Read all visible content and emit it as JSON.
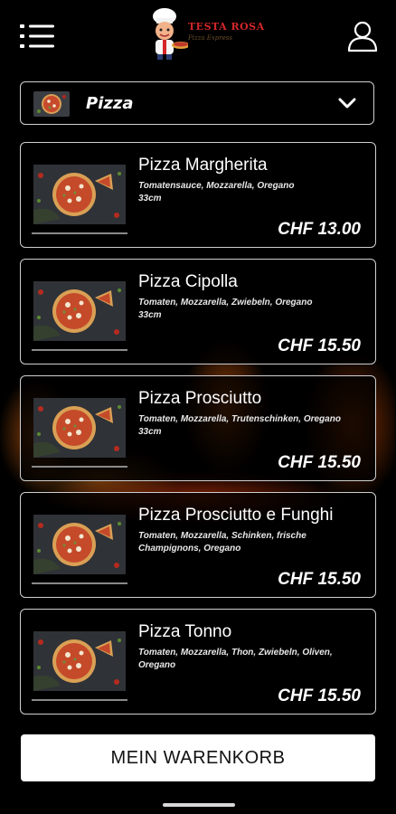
{
  "brand": {
    "name": "TESTA ROSA",
    "tagline": "Pizza Express"
  },
  "icons": {
    "menu": "menu-list-icon",
    "user": "user-icon",
    "dropdown": "chevron-down-icon"
  },
  "category": {
    "label": "Pizza"
  },
  "products": [
    {
      "name": "Pizza Margherita",
      "desc": "Tomatensauce, Mozzarella, Oregano",
      "size": "33cm",
      "price": "CHF 13.00"
    },
    {
      "name": "Pizza Cipolla",
      "desc": "Tomaten, Mozzarella, Zwiebeln, Oregano",
      "size": "33cm",
      "price": "CHF 15.50"
    },
    {
      "name": "Pizza Prosciutto",
      "desc": "Tomaten, Mozzarella, Trutenschinken, Oregano",
      "size": "33cm",
      "price": "CHF 15.50"
    },
    {
      "name": "Pizza Prosciutto e Funghi",
      "desc": "Tomaten, Mozzarella, Schinken, frische Champignons, Oregano",
      "size": "",
      "price": "CHF 15.50"
    },
    {
      "name": "Pizza Tonno",
      "desc": "Tomaten, Mozzarella, Thon, Zwiebeln, Oliven, Oregano",
      "size": "",
      "price": "CHF 15.50"
    }
  ],
  "cart": {
    "label": "MEIN WARENKORB"
  },
  "colors": {
    "background": "#000000",
    "logo_red": "#d4262a",
    "button_bg": "#ffffff"
  }
}
